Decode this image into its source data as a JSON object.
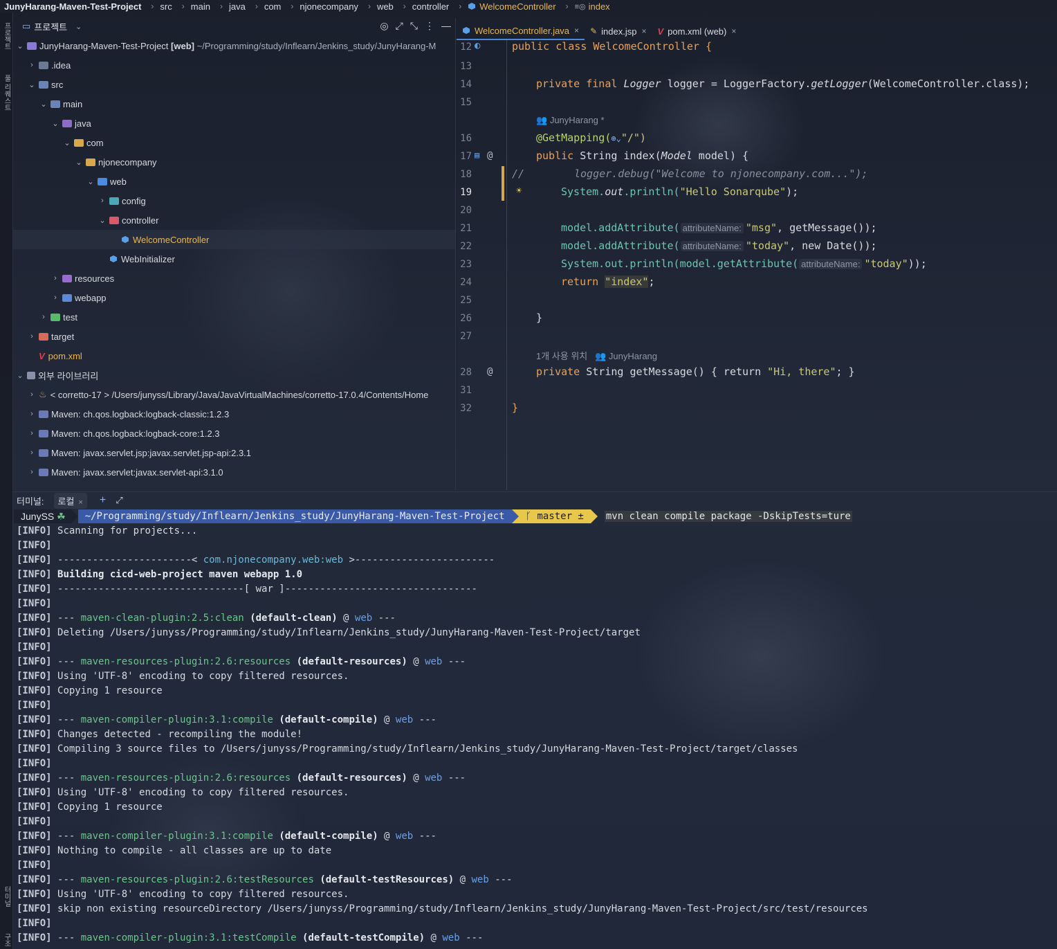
{
  "breadcrumb": {
    "project": "JunyHarang-Maven-Test-Project",
    "items": [
      "src",
      "main",
      "java",
      "com",
      "njonecompany",
      "web",
      "controller"
    ],
    "class": "WelcomeController",
    "method": "index"
  },
  "side_stripe": {
    "top_label": "프로젝트",
    "mid_label": "풀 리퀘스트",
    "bottom_label": "터미널",
    "bottom2_label": "구조"
  },
  "project_panel": {
    "title": "프로젝트",
    "tree": [
      {
        "label": "JunyHarang-Maven-Test-Project",
        "extra": "[web]",
        "path": "~/Programming/study/Inflearn/Jenkins_study/JunyHarang-M"
      },
      {
        "label": ".idea"
      },
      {
        "label": "src"
      },
      {
        "label": "main"
      },
      {
        "label": "java"
      },
      {
        "label": "com"
      },
      {
        "label": "njonecompany"
      },
      {
        "label": "web"
      },
      {
        "label": "config"
      },
      {
        "label": "controller"
      },
      {
        "label": "WelcomeController"
      },
      {
        "label": "WebInitializer"
      },
      {
        "label": "resources"
      },
      {
        "label": "webapp"
      },
      {
        "label": "test"
      },
      {
        "label": "target"
      },
      {
        "label": "pom.xml"
      },
      {
        "label": "외부 라이브러리"
      },
      {
        "label": "< corretto-17 > /Users/junyss/Library/Java/JavaVirtualMachines/corretto-17.0.4/Contents/Home"
      },
      {
        "label": "Maven: ch.qos.logback:logback-classic:1.2.3"
      },
      {
        "label": "Maven: ch.qos.logback:logback-core:1.2.3"
      },
      {
        "label": "Maven: javax.servlet.jsp:javax.servlet.jsp-api:2.3.1"
      },
      {
        "label": "Maven: javax.servlet:javax.servlet-api:3.1.0"
      }
    ]
  },
  "editor": {
    "tabs": [
      {
        "label": "WelcomeController.java",
        "active": true
      },
      {
        "label": "index.jsp",
        "active": false
      },
      {
        "label": "pom.xml (web)",
        "active": false
      }
    ],
    "line_numbers": [
      "12",
      "13",
      "14",
      "15",
      "16",
      "17",
      "18",
      "19",
      "20",
      "21",
      "22",
      "23",
      "24",
      "25",
      "26",
      "27",
      "28",
      "31",
      "32"
    ],
    "author_hint_1": "JunyHarang *",
    "author_hint_2_usage": "1개 사용 위치",
    "author_hint_2": "JunyHarang",
    "code": {
      "l12": "public class WelcomeController {",
      "l14_a": "private final ",
      "l14_b": "Logger",
      "l14_c": " logger = LoggerFactory.",
      "l14_d": "getLogger",
      "l14_e": "(WelcomeController.class);",
      "l16_a": "@GetMapping(",
      "l16_b": "\"/\")",
      "l17_a": "public ",
      "l17_b": "String index(",
      "l17_c": "Model",
      "l17_d": " model) {",
      "l18_cmt": "//",
      "l18": "logger.debug(\"Welcome to njonecompany.com...\");",
      "l19_a": "System.",
      "l19_b": "out",
      "l19_c": ".println(",
      "l19_d": "\"Hello Sonarqube\"",
      "l19_e": ");",
      "l21_a": "model.addAttribute(",
      "l21_hint": "attributeName:",
      "l21_b": "\"msg\"",
      "l21_c": ", getMessage());",
      "l22_a": "model.addAttribute(",
      "l22_hint": "attributeName:",
      "l22_b": "\"today\"",
      "l22_c": ", new Date());",
      "l23_a": "System.out.println(model.getAttribute(",
      "l23_hint": "attributeName:",
      "l23_b": "\"today\"",
      "l23_c": "));",
      "l24_a": "return ",
      "l24_b": "\"index\"",
      "l24_c": ";",
      "l26": "}",
      "l28_a": "private ",
      "l28_b": "String getMessage() { return ",
      "l28_c": "\"Hi, there\"",
      "l28_d": "; }",
      "l32": "}"
    }
  },
  "terminal": {
    "title": "터미널:",
    "tab": "로컬",
    "prompt_user": "JunySS",
    "prompt_path": "~/Programming/study/Inflearn/Jenkins_study/JunyHarang-Maven-Test-Project",
    "prompt_branch": "master ±",
    "command": "mvn clean compile package -DskipTests=ture",
    "lines": [
      {
        "t": "plain",
        "text": "Scanning for projects..."
      },
      {
        "t": "plain",
        "text": ""
      },
      {
        "t": "artifact",
        "a": "-----------------------< ",
        "b": "com.njonecompany.web:web",
        "c": " >------------------------"
      },
      {
        "t": "bold",
        "text": "Building cicd-web-project maven webapp 1.0"
      },
      {
        "t": "plain",
        "text": "--------------------------------[ war ]---------------------------------"
      },
      {
        "t": "plain",
        "text": ""
      },
      {
        "t": "plugin",
        "plugin": "maven-clean-plugin:2.5:clean",
        "exec": "(default-clean)",
        "mod": "web"
      },
      {
        "t": "plain",
        "text": "Deleting /Users/junyss/Programming/study/Inflearn/Jenkins_study/JunyHarang-Maven-Test-Project/target"
      },
      {
        "t": "plain",
        "text": ""
      },
      {
        "t": "plugin",
        "plugin": "maven-resources-plugin:2.6:resources",
        "exec": "(default-resources)",
        "mod": "web"
      },
      {
        "t": "plain",
        "text": "Using 'UTF-8' encoding to copy filtered resources."
      },
      {
        "t": "plain",
        "text": "Copying 1 resource"
      },
      {
        "t": "plain",
        "text": ""
      },
      {
        "t": "plugin",
        "plugin": "maven-compiler-plugin:3.1:compile",
        "exec": "(default-compile)",
        "mod": "web"
      },
      {
        "t": "plain",
        "text": "Changes detected - recompiling the module!"
      },
      {
        "t": "plain",
        "text": "Compiling 3 source files to /Users/junyss/Programming/study/Inflearn/Jenkins_study/JunyHarang-Maven-Test-Project/target/classes"
      },
      {
        "t": "plain",
        "text": ""
      },
      {
        "t": "plugin",
        "plugin": "maven-resources-plugin:2.6:resources",
        "exec": "(default-resources)",
        "mod": "web"
      },
      {
        "t": "plain",
        "text": "Using 'UTF-8' encoding to copy filtered resources."
      },
      {
        "t": "plain",
        "text": "Copying 1 resource"
      },
      {
        "t": "plain",
        "text": ""
      },
      {
        "t": "plugin",
        "plugin": "maven-compiler-plugin:3.1:compile",
        "exec": "(default-compile)",
        "mod": "web"
      },
      {
        "t": "plain",
        "text": "Nothing to compile - all classes are up to date"
      },
      {
        "t": "plain",
        "text": ""
      },
      {
        "t": "plugin",
        "plugin": "maven-resources-plugin:2.6:testResources",
        "exec": "(default-testResources)",
        "mod": "web"
      },
      {
        "t": "plain",
        "text": "Using 'UTF-8' encoding to copy filtered resources."
      },
      {
        "t": "plain",
        "text": "skip non existing resourceDirectory /Users/junyss/Programming/study/Inflearn/Jenkins_study/JunyHarang-Maven-Test-Project/src/test/resources"
      },
      {
        "t": "plain",
        "text": ""
      },
      {
        "t": "plugin",
        "plugin": "maven-compiler-plugin:3.1:testCompile",
        "exec": "(default-testCompile)",
        "mod": "web"
      }
    ],
    "info_tag": "[INFO]",
    "plugin_prefix": "---",
    "plugin_at": "@",
    "plugin_suffix": "---"
  }
}
